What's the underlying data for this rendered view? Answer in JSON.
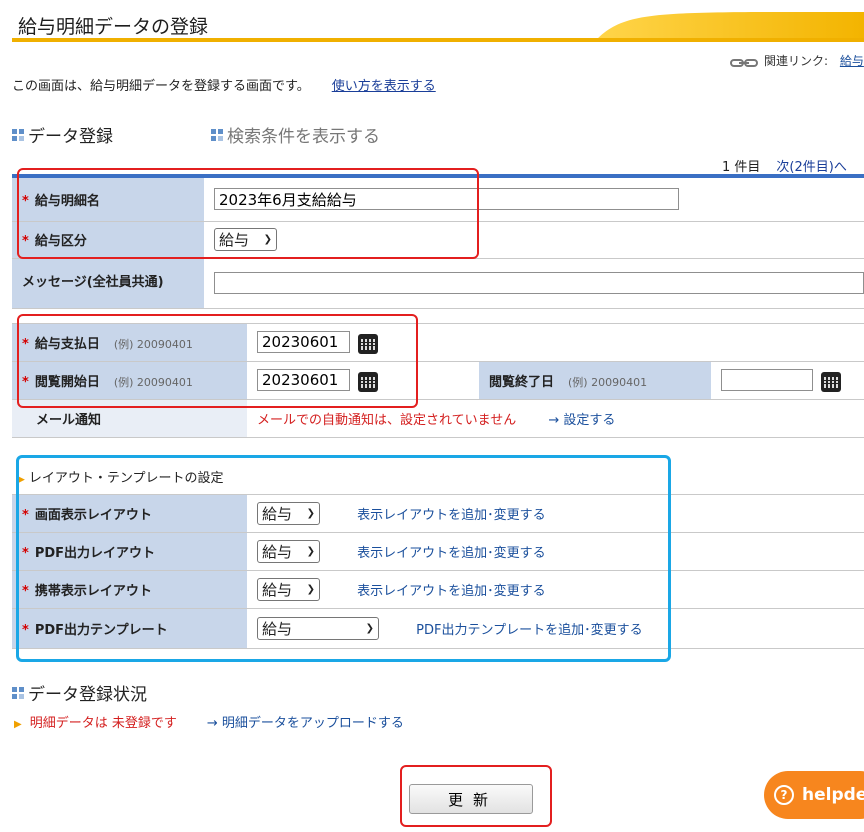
{
  "page": {
    "title": "給与明細データの登録",
    "related_label": "関連リンク:",
    "related_link": "給与",
    "intro": "この画面は、給与明細データを登録する画面です。",
    "howto_link": "使い方を表示する"
  },
  "sections": {
    "data_entry": "データ登録",
    "search_toggle": "検索条件を表示する",
    "status": "データ登録状況"
  },
  "pager": {
    "count": "1 件目",
    "next": "次(2件目)へ"
  },
  "form": {
    "name_label": "給与明細名",
    "name_value": "2023年6月支給給与",
    "type_label": "給与区分",
    "type_value": "給与",
    "message_label": "メッセージ(全社員共通)",
    "message_value": "",
    "pay_date_label": "給与支払日",
    "pay_date_example": "(例) 20090401",
    "pay_date_value": "20230601",
    "view_start_label": "閲覧開始日",
    "view_start_example": "(例) 20090401",
    "view_start_value": "20230601",
    "view_end_label": "閲覧終了日",
    "view_end_example": "(例) 20090401",
    "view_end_value": "",
    "mail_label": "メール通知",
    "mail_status": "メールでの自動通知は、設定されていません",
    "mail_setting": "→  設定する"
  },
  "layout_settings": {
    "heading": "レイアウト・テンプレートの設定",
    "rows": [
      {
        "label": "画面表示レイアウト",
        "value": "給与",
        "link": "表示レイアウトを追加･変更する"
      },
      {
        "label": "PDF出力レイアウト",
        "value": "給与",
        "link": "表示レイアウトを追加･変更する"
      },
      {
        "label": "携帯表示レイアウト",
        "value": "給与",
        "link": "表示レイアウトを追加･変更する"
      },
      {
        "label": "PDF出力テンプレート",
        "value": "給与",
        "link": "PDF出力テンプレートを追加･変更する"
      }
    ]
  },
  "status": {
    "message": "明細データは 未登録です",
    "upload_link": "→  明細データをアップロードする"
  },
  "actions": {
    "update": "更新"
  },
  "help": {
    "label": "helpdes"
  },
  "colors": {
    "accent": "#f0b000",
    "label_bg": "#c8d6ea",
    "required": "#d40000",
    "link": "#1a4f9c",
    "help": "#f7861e"
  }
}
